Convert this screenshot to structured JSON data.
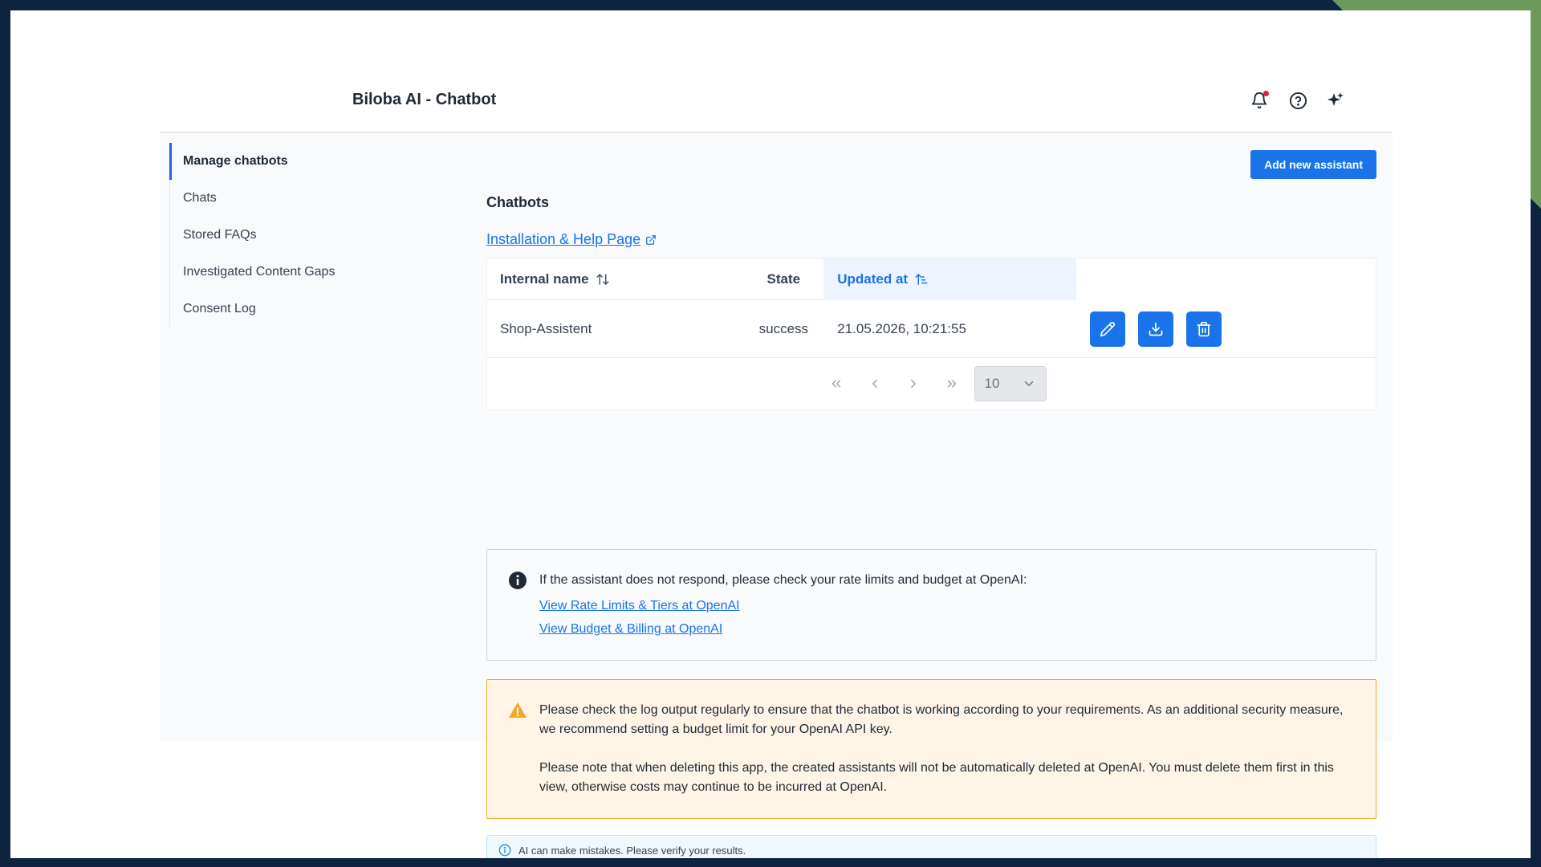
{
  "app": {
    "title": "Biloba AI - Chatbot"
  },
  "topbar": {
    "icons": [
      "bell-icon",
      "help-circle-icon",
      "sparkles-icon"
    ],
    "notification_dot_color": "#e11d48"
  },
  "sidebar": {
    "items": [
      {
        "label": "Manage chatbots",
        "active": true
      },
      {
        "label": "Chats"
      },
      {
        "label": "Stored FAQs"
      },
      {
        "label": "Investigated Content Gaps"
      },
      {
        "label": "Consent Log"
      }
    ]
  },
  "main": {
    "add_button_label": "Add new assistant",
    "section_title": "Chatbots",
    "help_link_label": "Installation & Help Page",
    "table": {
      "columns": {
        "name": "Internal name",
        "state": "State",
        "updated": "Updated at"
      },
      "rows": [
        {
          "name": "Shop-Assistent",
          "state": "success",
          "updated": "21.05.2026, 10:21:55"
        }
      ],
      "row_actions": [
        "edit-icon",
        "download-icon",
        "trash-icon"
      ]
    },
    "pagination": {
      "page_size": "10"
    },
    "info": {
      "text": "If the assistant does not respond, please check your rate limits and budget at OpenAI:",
      "link_rate_limits": "View Rate Limits & Tiers at OpenAI",
      "link_billing": "View Budget & Billing at OpenAI"
    },
    "warning": {
      "paragraph1": "Please check the log output regularly to ensure that the chatbot is working according to your requirements. As an additional security measure, we recommend setting a budget limit for your OpenAI API key.",
      "paragraph2": "Please note that when deleting this app, the created assistants will not be automatically deleted at OpenAI. You must delete them first in this view, otherwise costs may continue to be incurred at OpenAI."
    },
    "ai_note": "AI can make mistakes. Please verify your results."
  },
  "colors": {
    "primary": "#1a73e8",
    "warning_bg": "#fff4e5",
    "warning_border": "#f5a623",
    "note_bg": "#eff8fd"
  }
}
